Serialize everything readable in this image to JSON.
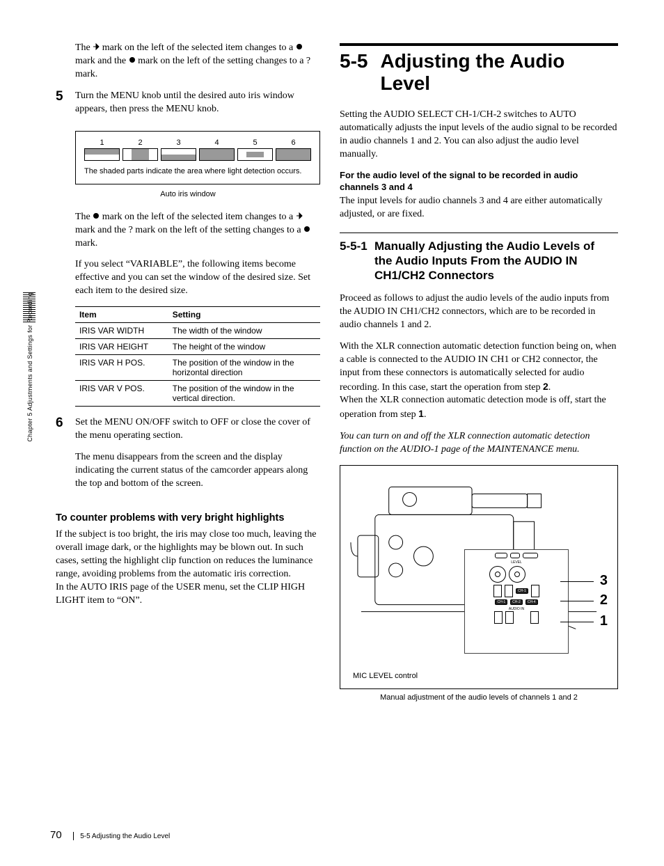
{
  "left": {
    "p1_a": "The ",
    "p1_b": " mark on the left of the selected item changes to a ",
    "p1_c": " mark and the ",
    "p1_d": " mark on the left of the setting changes to a ? mark.",
    "step5_num": "5",
    "step5_text": "Turn the MENU knob until the desired auto iris window appears, then press the MENU knob.",
    "iris_labels": [
      "1",
      "2",
      "3",
      "4",
      "5",
      "6"
    ],
    "iris_note": "The shaded parts indicate the area where light detection occurs.",
    "iris_caption": "Auto iris window",
    "p2_a": "The ",
    "p2_b": " mark on the left of the selected item changes to a ",
    "p2_c": " mark and the ? mark on the left of the setting changes to a ",
    "p2_d": " mark.",
    "p3": "If you select “VARIABLE”, the following items become effective and you can set the window of the desired size. Set each item to the desired size.",
    "table": {
      "headers": [
        "Item",
        "Setting"
      ],
      "rows": [
        [
          "IRIS VAR WIDTH",
          "The width of the window"
        ],
        [
          "IRIS VAR HEIGHT",
          "The height of the window"
        ],
        [
          "IRIS VAR H POS.",
          "The position of the window in the horizontal direction"
        ],
        [
          "IRIS VAR V POS.",
          "The position of the window in the vertical direction."
        ]
      ]
    },
    "step6_num": "6",
    "step6_text": "Set the MENU ON/OFF switch to OFF or close the cover of the menu operating section.",
    "step6_p2": "The menu disappears from the screen and the display indicating the current status of the camcorder appears along the top and bottom of the screen.",
    "h3": "To counter problems with very bright highlights",
    "p4": "If the subject is too bright, the iris may close too much, leaving the overall image dark, or the highlights may be blown out. In such cases, setting the highlight clip function on reduces the luminance range, avoiding problems from the automatic iris correction.",
    "p5": "In the AUTO IRIS page of the USER menu, set the CLIP HIGH LIGHT item to “ON”."
  },
  "right": {
    "h1_num": "5-5",
    "h1_title": "Adjusting the Audio Level",
    "p1": "Setting the AUDIO SELECT CH-1/CH-2 switches to AUTO automatically adjusts the input levels of the audio signal to be recorded in audio channels 1 and 2. You can also adjust the audio level manually.",
    "h4": "For the audio level of the signal to be recorded in audio channels 3 and 4",
    "p2": "The input levels for audio channels 3 and 4 are either automatically adjusted, or are fixed.",
    "h2_num": "5-5-1",
    "h2_title": "Manually Adjusting the Audio Levels of the Audio Inputs From the AUDIO IN CH1/CH2 Connectors",
    "p3": "Proceed as follows to adjust the audio levels of the audio inputs from the AUDIO IN CH1/CH2 connectors, which are to be recorded in audio channels 1 and 2.",
    "p4_a": "With the XLR connection automatic detection function being on, when a cable is connected to the AUDIO IN CH1 or CH2 connector, the input from these connectors is automatically selected for audio recording. In this case, start the operation from step ",
    "p4_bold1": "2",
    "p4_b": ".",
    "p4_c": "When the XLR connection automatic detection mode is off, start the operation from step ",
    "p4_bold2": "1",
    "p4_d": ".",
    "p5_italic": "You can turn on and off the XLR connection automatic detection function on the AUDIO-1 page of the MAINTENANCE menu.",
    "callouts": [
      "3",
      "2",
      "1"
    ],
    "mic_label": "MIC LEVEL control",
    "panel_level": "LEVEL",
    "panel_audioin": "AUDIO IN",
    "caption": "Manual adjustment of the audio levels of channels 1 and 2"
  },
  "sidebar": "Chapter 5  Adjustments and Settings for Recording",
  "footer": {
    "page": "70",
    "text": "5-5 Adjusting the Audio Level"
  }
}
